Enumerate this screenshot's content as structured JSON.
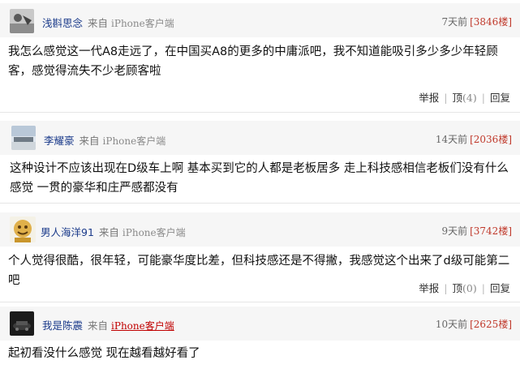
{
  "comments": [
    {
      "username": "浅斟思念",
      "from_label": "来自",
      "client": "iPhone客户端",
      "time": "7天前",
      "floor": "[3846楼]",
      "text": "我怎么感觉这一代A8走远了，在中国买A8的更多的中庸派吧，我不知道能吸引多少多少年轻顾客，感觉得流失不少老顾客啦",
      "report": "举报",
      "like_label": "顶",
      "like_count": "(4)",
      "reply": "回复"
    },
    {
      "username": "李耀豪",
      "from_label": "来自",
      "client": "iPhone客户端",
      "time": "14天前",
      "floor": "[2036楼]",
      "text": "这种设计不应该出现在D级车上啊  基本买到它的人都是老板居多  走上科技感相信老板们没有什么感觉  一贯的豪华和庄严感都没有"
    },
    {
      "username": "男人海洋91",
      "from_label": "来自",
      "client": "iPhone客户端",
      "time": "9天前",
      "floor": "[3742楼]",
      "text": "个人觉得很酷，很年轻，可能豪华度比差，但科技感还是不得撇，我感觉这个出来了d级可能第二吧",
      "report": "举报",
      "like_label": "顶",
      "like_count": "(0)",
      "reply": "回复"
    },
    {
      "username": "我是陈震",
      "from_label": "来自",
      "client": "iPhone客户端",
      "time": "10天前",
      "floor": "[2625楼]",
      "text": "起初看没什么感觉  现在越看越好看了"
    }
  ]
}
